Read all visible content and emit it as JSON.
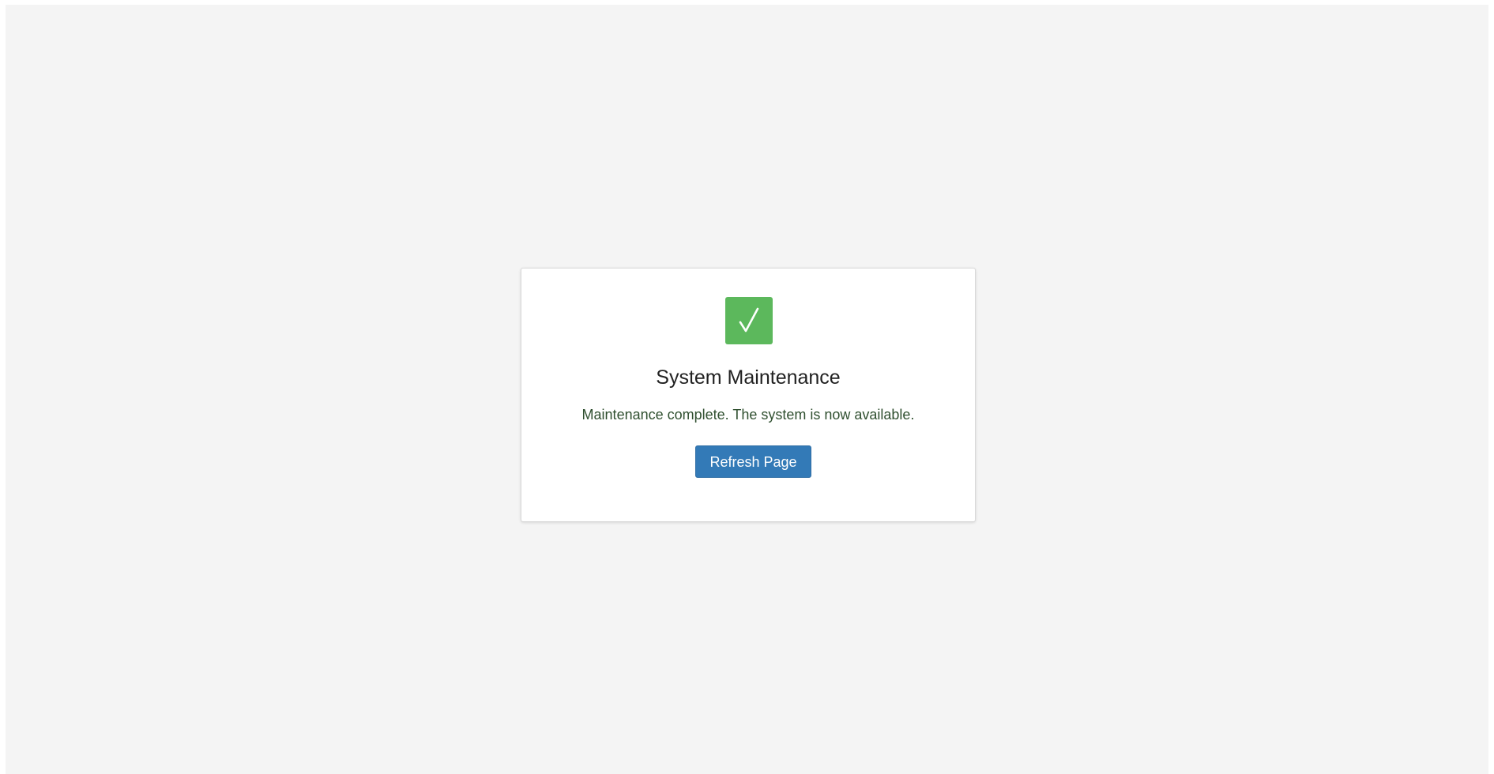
{
  "page": {
    "background_color": "#f4f4f4"
  },
  "card": {
    "icon": "checkmark-icon",
    "icon_color": "#5cb85c",
    "title": "System Maintenance",
    "message": "Maintenance complete. The system is now available.",
    "message_color": "#2f4f2f",
    "refresh_button_label": "Refresh Page",
    "button_color": "#337ab7"
  }
}
